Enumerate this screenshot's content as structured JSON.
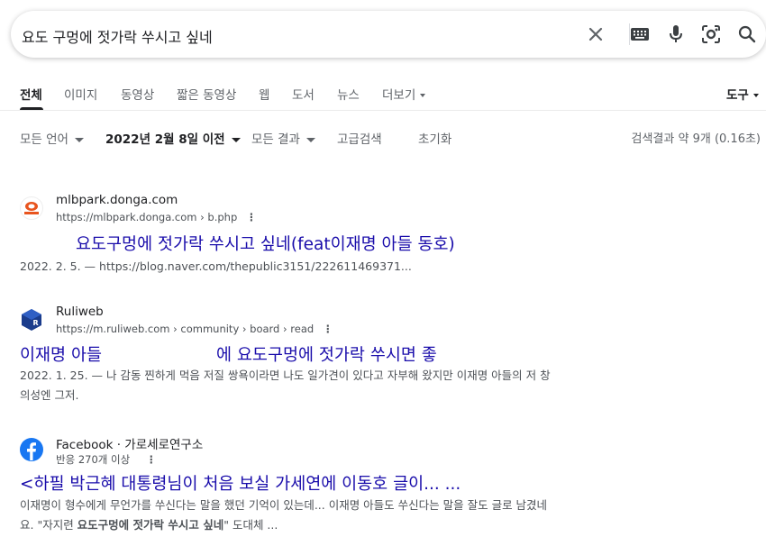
{
  "search": {
    "query": "요도 구멍에 젓가락 쑤시고 싶네",
    "icons": [
      "close-icon",
      "keyboard-icon",
      "mic-icon",
      "lens-icon",
      "search-icon"
    ]
  },
  "tabs": [
    {
      "label": "전체",
      "active": true
    },
    {
      "label": "이미지"
    },
    {
      "label": "동영상"
    },
    {
      "label": "짧은 동영상"
    },
    {
      "label": "웹"
    },
    {
      "label": "도서"
    },
    {
      "label": "뉴스"
    },
    {
      "label": "더보기"
    }
  ],
  "tools_label": "도구",
  "filters": {
    "language": "모든 언어",
    "date": "2022년 2월 8일 이전",
    "results": "모든 결과",
    "advanced": "고급검색",
    "reset": "초기화",
    "stats": "검색결과 약 9개 (0.16초)"
  },
  "results": [
    {
      "site_name": "mlbpark.donga.com",
      "url": "https://mlbpark.donga.com › b.php",
      "title": "요도구멍에 젓가락 쑤시고 싶네(feat이재명 아들 동호)",
      "snippet": "2022. 2. 5. — https://blog.naver.com/thepublic3151/222611469371..."
    },
    {
      "site_name": "Ruliweb",
      "url": "https://m.ruliweb.com › community › board › read",
      "title_left": "이재명 아들",
      "title_right": "에 요도구멍에 젓가락 쑤시면 좋",
      "snippet_line1": "2022. 1. 25. — 나 감동 찐하게 먹음 저질 쌍욕이라면 나도 일가견이 있다고 자부해 왔지만 이재명 아들의 저 창",
      "snippet_line2": "의성엔 그저."
    },
    {
      "site_name": "Facebook · 가로세로연구소",
      "url": "반응 270개 이상",
      "title": "<하필 박근혜 대통령님이 처음 보실 가세연에 이동호 글이... ...",
      "snippet_line1": "이재명이 형수에게 무언가를 쑤신다는 말을 했던 기억이 있는데... 이재명 아들도 쑤신다는 말을 잘도 글로 남겼네",
      "snippet_line2_pre": "요. \"자지련 ",
      "snippet_line2_bold": "요도구멍에 젓가락 쑤시고 싶네",
      "snippet_line2_post": "\" 도대체 ..."
    }
  ],
  "colors": {
    "link": "#1a0dab",
    "text": "#202124",
    "secondary": "#5f6368",
    "snippet": "#4d5156",
    "facebook": "#1877f2",
    "ruliweb": "#1a3c8c",
    "mlbpark": "#e8541e"
  }
}
